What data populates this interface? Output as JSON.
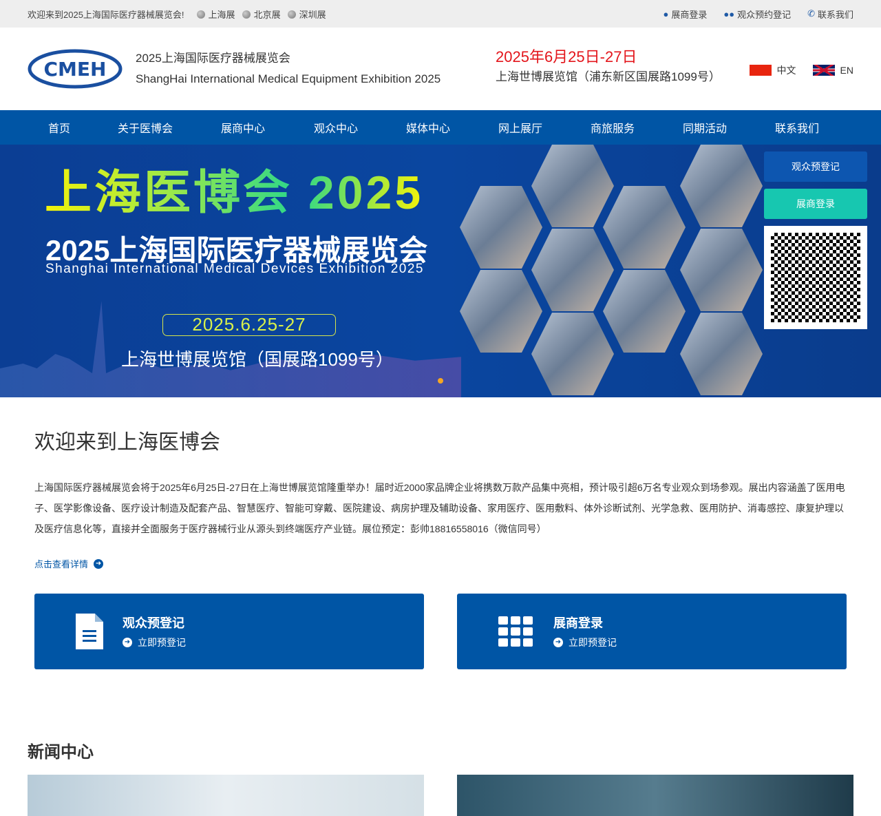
{
  "topbar": {
    "welcome": "欢迎来到2025上海国际医疗器械展览会!",
    "sites": [
      "上海展",
      "北京展",
      "深圳展"
    ],
    "links": [
      "展商登录",
      "观众预约登记",
      "联系我们"
    ]
  },
  "header": {
    "logo_text": "CMEH",
    "title_cn": "2025上海国际医疗器械展览会",
    "title_en": "ShangHai International Medical Equipment Exhibition 2025",
    "date": "2025年6月25日-27日",
    "venue": "上海世博展览馆（浦东新区国展路1099号）",
    "lang": [
      "中文",
      "EN"
    ]
  },
  "nav": [
    "首页",
    "关于医博会",
    "展商中心",
    "观众中心",
    "媒体中心",
    "网上展厅",
    "商旅服务",
    "同期活动",
    "联系我们"
  ],
  "banner": {
    "title": "上海医博会 2025",
    "subtitle": "2025上海国际医疗器械展览会",
    "english": "Shanghai International Medical Devices Exhibition 2025",
    "date": "2025.6.25-27",
    "venue": "上海世博展览馆（国展路1099号）",
    "btn_visitor": "观众预登记",
    "btn_exhibitor": "展商登录"
  },
  "welcome": {
    "title": "欢迎来到上海医博会",
    "text": "上海国际医疗器械展览会将于2025年6月25日-27日在上海世博展览馆隆重举办！届时近2000家品牌企业将携数万款产品集中亮相，预计吸引超6万名专业观众到场参观。展出内容涵盖了医用电子、医学影像设备、医疗设计制造及配套产品、智慧医疗、智能可穿戴、医院建设、病房护理及辅助设备、家用医疗、医用敷料、体外诊断试剂、光学急救、医用防护、消毒感控、康复护理以及医疗信息化等，直接并全面服务于医疗器械行业从源头到终端医疗产业链。展位预定：彭帅18816558016（微信同号）",
    "more": "点击查看详情"
  },
  "cards": [
    {
      "title": "观众预登记",
      "sub": "立即预登记"
    },
    {
      "title": "展商登录",
      "sub": "立即预登记"
    }
  ],
  "news": {
    "title": "新闻中心"
  }
}
